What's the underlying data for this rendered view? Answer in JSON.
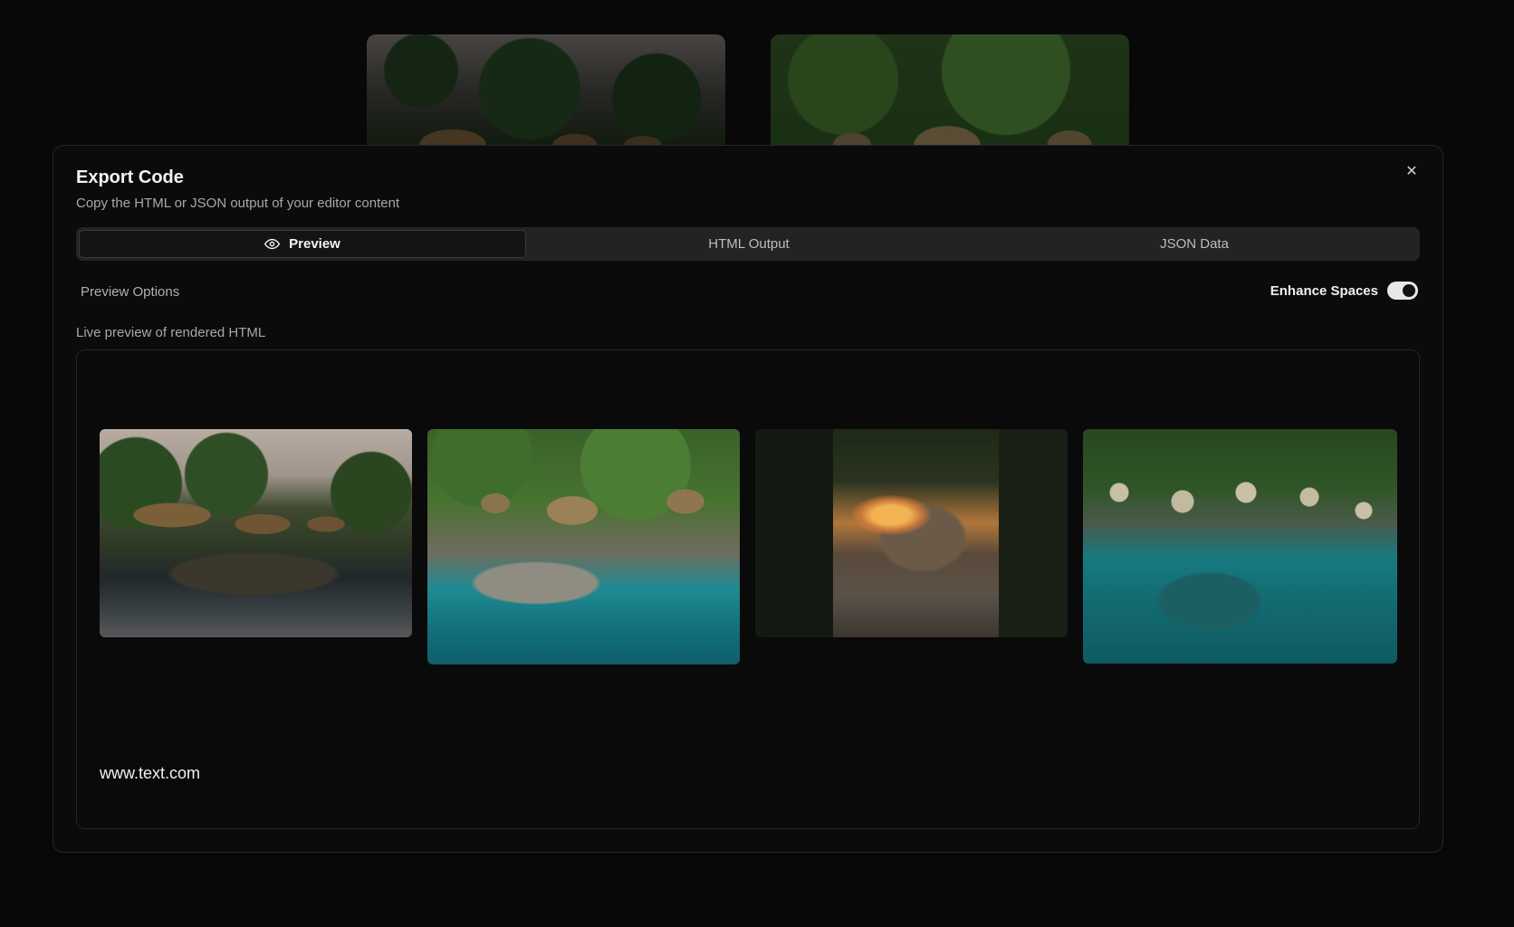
{
  "modal": {
    "title": "Export Code",
    "subtitle": "Copy the HTML or JSON output of your editor content",
    "close_icon": "close-icon"
  },
  "tabs": [
    {
      "label": "Preview",
      "icon": "eye-icon",
      "active": true
    },
    {
      "label": "HTML Output",
      "active": false
    },
    {
      "label": "JSON Data",
      "active": false
    }
  ],
  "preview_options": {
    "label": "Preview Options",
    "toggle_label": "Enhance Spaces",
    "toggle_on": true
  },
  "live_preview": {
    "label": "Live preview of rendered HTML",
    "images": [
      {
        "subject": "thatched huts on cliff at dusk over calm water"
      },
      {
        "subject": "thatched huts on rocky cliff over turquoise water"
      },
      {
        "subject": "stone pathway through archway toward sunset"
      },
      {
        "subject": "aerial view of coastline with huts and turquoise sea"
      }
    ],
    "url_text": "www.text.com"
  },
  "colors": {
    "background": "#0d0d0d",
    "modal": "#0b0b0b",
    "tab_bar": "#232323",
    "accent": "#e8e8e8"
  }
}
